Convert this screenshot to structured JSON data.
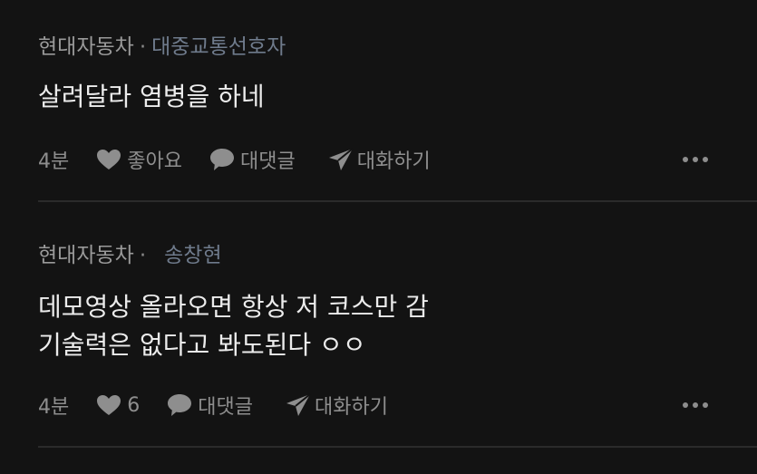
{
  "comments": [
    {
      "author": "현대자동차",
      "separator": "·",
      "subname": "대중교통선호자",
      "lines": [
        "살려달라 염병을 하네"
      ],
      "time": "4분",
      "like_label": "좋아요",
      "reply_label": "대댓글",
      "chat_label": "대화하기"
    },
    {
      "author": "현대자동차",
      "separator": "·",
      "subname": "송창현",
      "lines": [
        "데모영상 올라오면 항상 저 코스만 감",
        "기술력은 없다고 봐도된다 ㅇㅇ"
      ],
      "time": "4분",
      "like_label": "6",
      "reply_label": "대댓글",
      "chat_label": "대화하기"
    }
  ],
  "icons": {
    "like": "heart-icon",
    "reply": "speech-bubble-icon",
    "chat": "send-icon",
    "more": "more-dots-icon"
  },
  "colors": {
    "background": "#131313",
    "text": "#ececec",
    "muted": "#8e8e8e",
    "subname": "#6f7b8c",
    "divider": "#2b2b2b"
  }
}
